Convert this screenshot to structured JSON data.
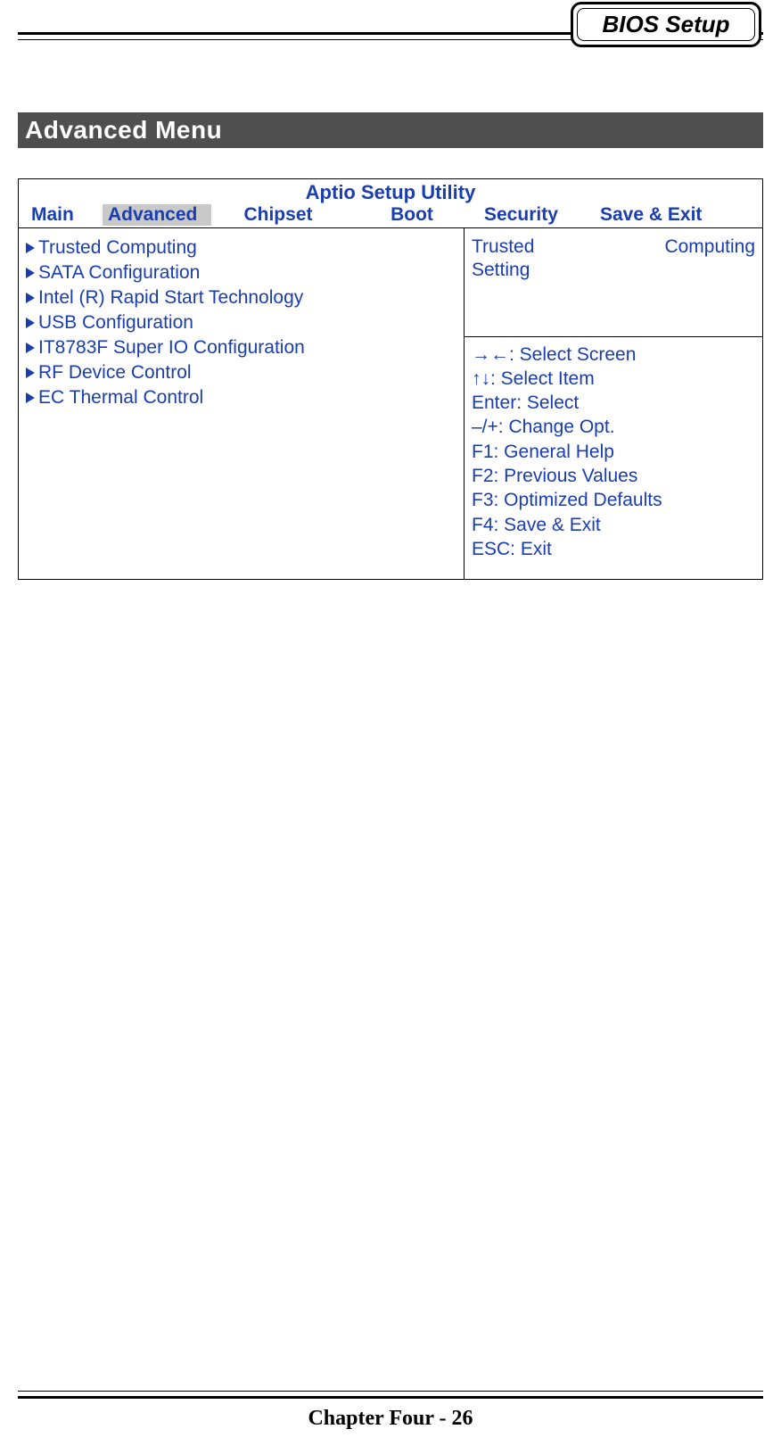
{
  "header": {
    "badge": "BIOS Setup"
  },
  "section": {
    "heading": "Advanced Menu"
  },
  "bios": {
    "title": "Aptio Setup Utility",
    "tabs": {
      "main": "Main",
      "advanced": "Advanced",
      "chipset": "Chipset",
      "boot": "Boot",
      "security": "Security",
      "save": "Save & Exit"
    },
    "menu": [
      "Trusted Computing",
      "SATA Configuration",
      "Intel (R) Rapid Start Technology",
      "USB Configuration",
      "IT8783F Super IO Configuration",
      "RF Device Control",
      "EC Thermal Control"
    ],
    "help_top": {
      "word1": "Trusted",
      "word2": "Computing",
      "word3": "Setting"
    },
    "help_bottom": [
      "→←: Select Screen",
      "↑↓: Select Item",
      "Enter: Select",
      "–/+: Change Opt.",
      "F1: General Help",
      "F2: Previous Values",
      "F3: Optimized Defaults",
      "F4: Save & Exit",
      "ESC: Exit"
    ]
  },
  "footer": {
    "text": "Chapter Four - 26"
  }
}
